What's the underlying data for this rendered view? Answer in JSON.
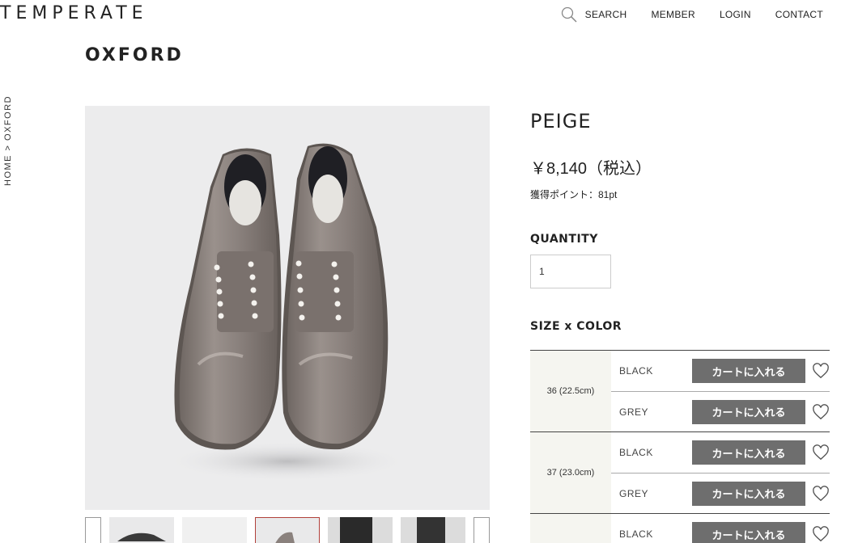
{
  "header": {
    "logo": "TEMPERATE",
    "nav": {
      "search": "SEARCH",
      "member": "MEMBER",
      "login": "LOGIN",
      "contact": "CONTACT"
    }
  },
  "page_title": "OXFORD",
  "breadcrumb": "HOME > OXFORD",
  "product": {
    "name": "PEIGE",
    "price": "￥8,140（税込）",
    "points": "獲得ポイント：81pt",
    "quantity_label": "QUANTITY",
    "quantity_value": "1",
    "size_color_label": "SIZE x COLOR",
    "colors": {
      "shoe_main": "#8d837f",
      "background": "#ececed",
      "button": "#6e6e6e",
      "active_thumb_border": "#b0403a"
    }
  },
  "variants": [
    {
      "size": "36 (22.5cm)",
      "colors": [
        {
          "name": "BLACK",
          "button": "カートに入れる"
        },
        {
          "name": "GREY",
          "button": "カートに入れる"
        }
      ]
    },
    {
      "size": "37 (23.0cm)",
      "colors": [
        {
          "name": "BLACK",
          "button": "カートに入れる"
        },
        {
          "name": "GREY",
          "button": "カートに入れる"
        }
      ]
    },
    {
      "size": "",
      "colors": [
        {
          "name": "BLACK",
          "button": "カートに入れる"
        }
      ]
    }
  ]
}
